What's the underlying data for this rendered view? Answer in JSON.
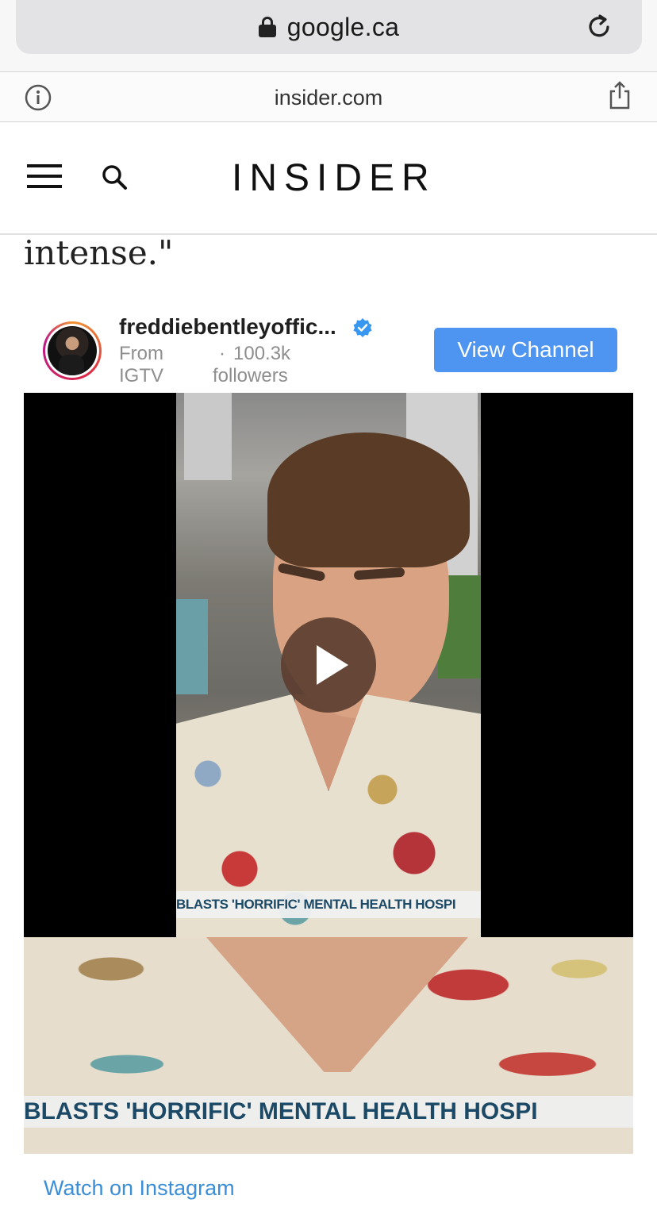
{
  "browser": {
    "url": "google.ca",
    "site_domain": "insider.com"
  },
  "header": {
    "logo": "INSIDER"
  },
  "article": {
    "text": "intense.\""
  },
  "instagram_embed": {
    "username": "freddiebentleyoffic...",
    "from_label": "From IGTV",
    "separator": "·",
    "followers": "100.3k followers",
    "view_channel_label": "View Channel",
    "video_caption": "BLASTS 'HORRIFIC' MENTAL HEALTH HOSPI",
    "still_caption": "BLASTS 'HORRIFIC' MENTAL HEALTH HOSPI",
    "watch_link": "Watch on Instagram"
  },
  "colors": {
    "accent_blue": "#4d95f0",
    "link_blue": "#3b8ed8",
    "verified_blue": "#3897f0"
  },
  "icons": [
    "lock-icon",
    "reload-icon",
    "info-icon",
    "share-icon",
    "menu-icon",
    "search-icon",
    "verified-icon",
    "play-icon"
  ]
}
